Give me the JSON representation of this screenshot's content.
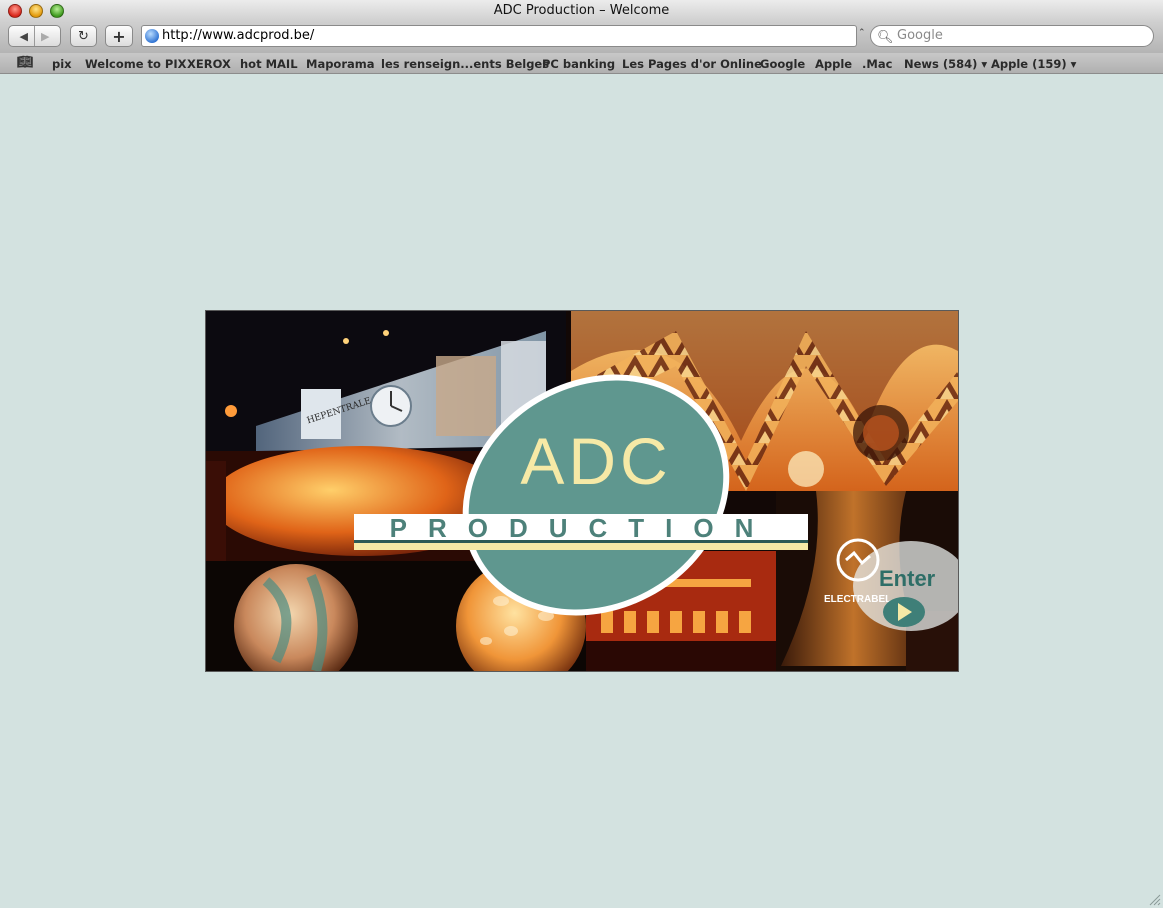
{
  "window": {
    "title": "ADC Production – Welcome"
  },
  "toolbar": {
    "back_icon": "◀",
    "forward_icon": "▶",
    "reload_icon": "↻",
    "add_icon": "+",
    "url": "http://www.adcprod.be/",
    "search_placeholder": "Google"
  },
  "bookmarks": [
    "pix",
    "Welcome to PIX",
    "XEROX",
    "hot MAIL",
    "Maporama",
    "les renseign...ents Belges",
    "PC banking",
    "Les Pages d'or Online",
    "Google",
    "Apple",
    ".Mac",
    "News (584) ▾",
    "Apple (159) ▾"
  ],
  "banner": {
    "logo_main": "ADC",
    "logo_sub": "PRODUCTION",
    "enter_label": "Enter",
    "sponsor": "ELECTRABEL",
    "billboard_text": "HEPENTRALE",
    "colors": {
      "logo_teal": "#5f978f",
      "logo_cream": "#f6e9a6",
      "page_bg": "#d3e2e0"
    }
  }
}
